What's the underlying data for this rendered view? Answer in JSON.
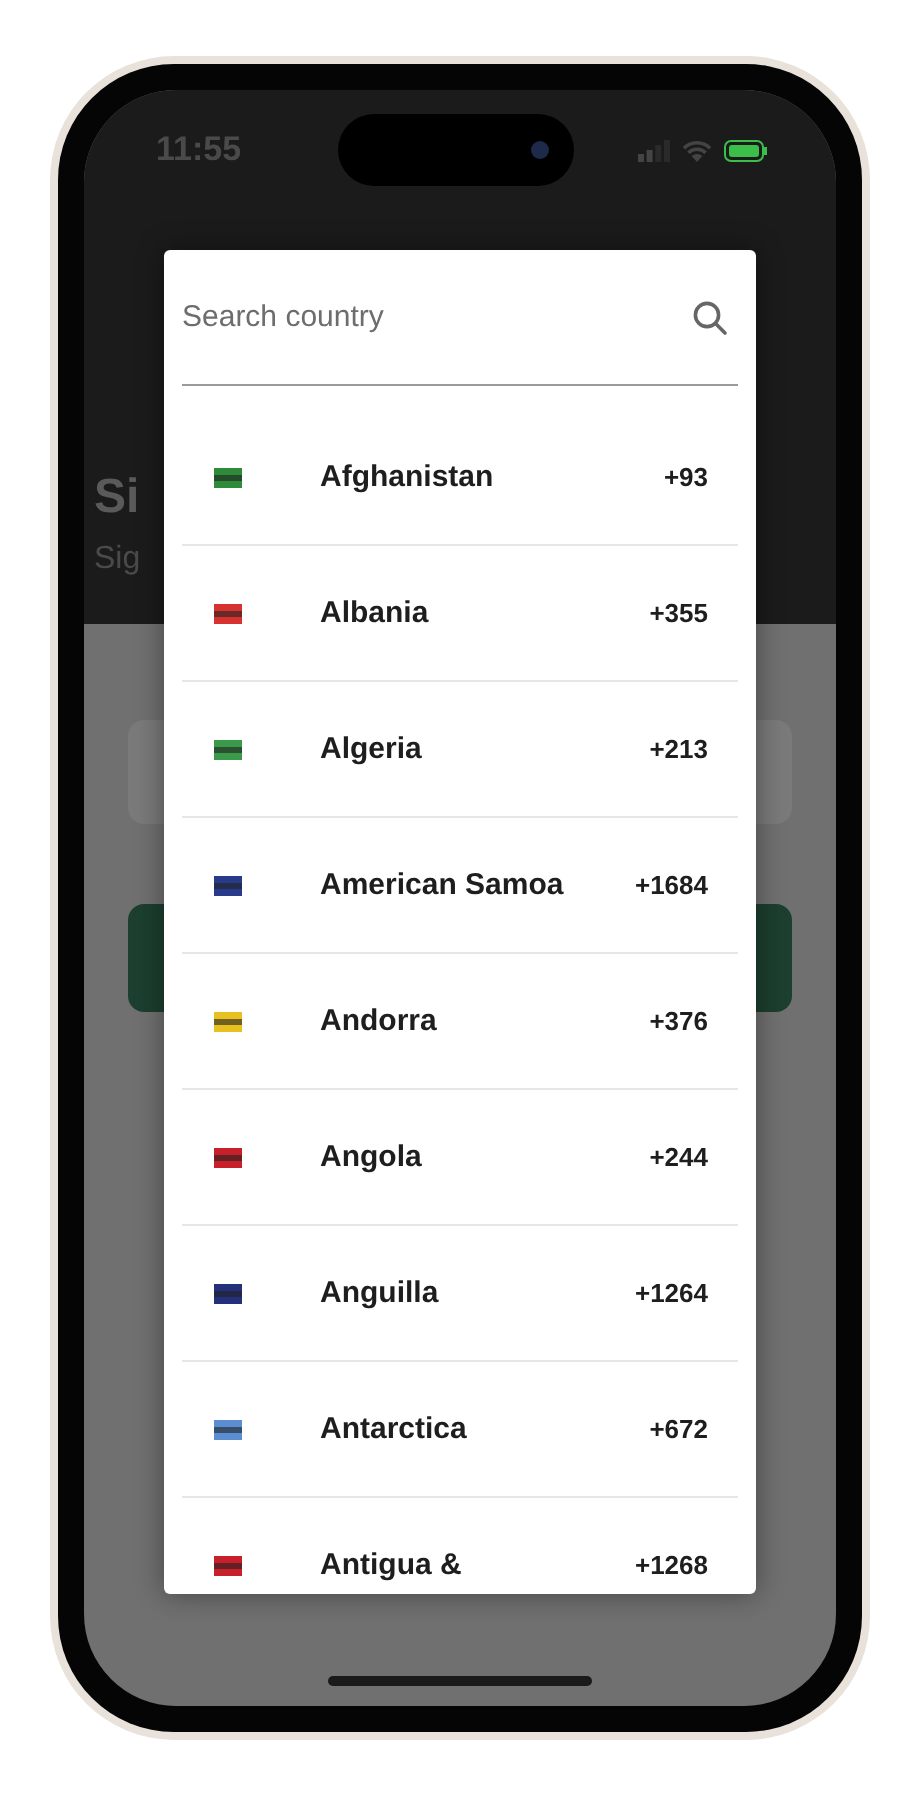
{
  "status_bar": {
    "time": "11:55"
  },
  "background_screen": {
    "title": "Si",
    "subtitle": "Sig"
  },
  "country_picker": {
    "search": {
      "placeholder": "Search country"
    },
    "countries": [
      {
        "name": "Afghanistan",
        "code": "+93",
        "color": "#2e8b3a"
      },
      {
        "name": "Albania",
        "code": "+355",
        "color": "#d6322f"
      },
      {
        "name": "Algeria",
        "code": "+213",
        "color": "#3a9a4a"
      },
      {
        "name": "American Samoa",
        "code": "+1684",
        "color": "#2a3a8a"
      },
      {
        "name": "Andorra",
        "code": "+376",
        "color": "#e8c020"
      },
      {
        "name": "Angola",
        "code": "+244",
        "color": "#c8202a"
      },
      {
        "name": "Anguilla",
        "code": "+1264",
        "color": "#24307a"
      },
      {
        "name": "Antarctica",
        "code": "+672",
        "color": "#5a8ed0"
      },
      {
        "name": "Antigua &",
        "code": "+1268",
        "color": "#c8202a"
      }
    ]
  }
}
